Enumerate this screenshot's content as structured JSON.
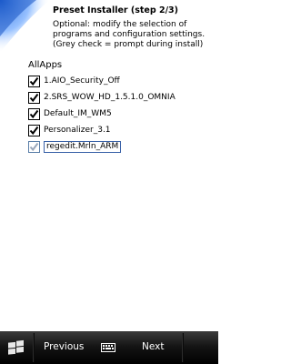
{
  "header": {
    "title": "Preset Installer (step 2/3)",
    "description": "Optional: modify the selection of programs and configuration settings. (Grey check = prompt during install)"
  },
  "section": {
    "label": "AllApps"
  },
  "items": [
    {
      "label": "1.AIO_Security_Off",
      "state": "checked"
    },
    {
      "label": "2.SRS_WOW_HD_1.5.1.0_OMNIA",
      "state": "checked"
    },
    {
      "label": "Default_IM_WM5",
      "state": "checked"
    },
    {
      "label": "Personalizer_3.1",
      "state": "checked"
    },
    {
      "label": "regedit.Mrln_ARM",
      "state": "grey"
    }
  ],
  "softkeys": {
    "start_icon": "windows-flag-icon",
    "left": "Previous",
    "keyboard_icon": "keyboard-icon",
    "right": "Next"
  },
  "colors": {
    "check": "#000000",
    "grey_check": "#9aa8bb",
    "accent_swoosh": "#3a7bd5",
    "bar": "#000000"
  }
}
